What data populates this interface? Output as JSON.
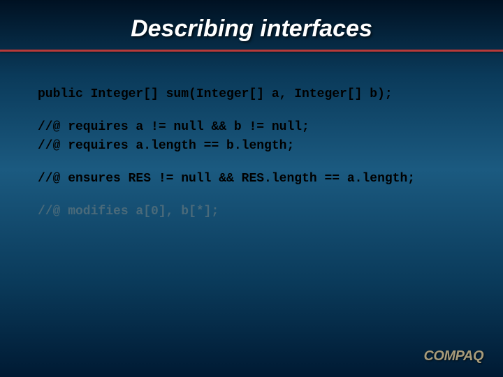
{
  "title": "Describing interfaces",
  "code": {
    "declaration": "public Integer[] sum(Integer[] a, Integer[] b);",
    "requires1": "//@ requires a != null && b != null;",
    "requires2": "//@ requires a.length == b.length;",
    "ensures": "//@ ensures RES != null && RES.length == a.length;",
    "modifies": "//@ modifies a[0], b[*];"
  },
  "logo": "COMPAQ"
}
